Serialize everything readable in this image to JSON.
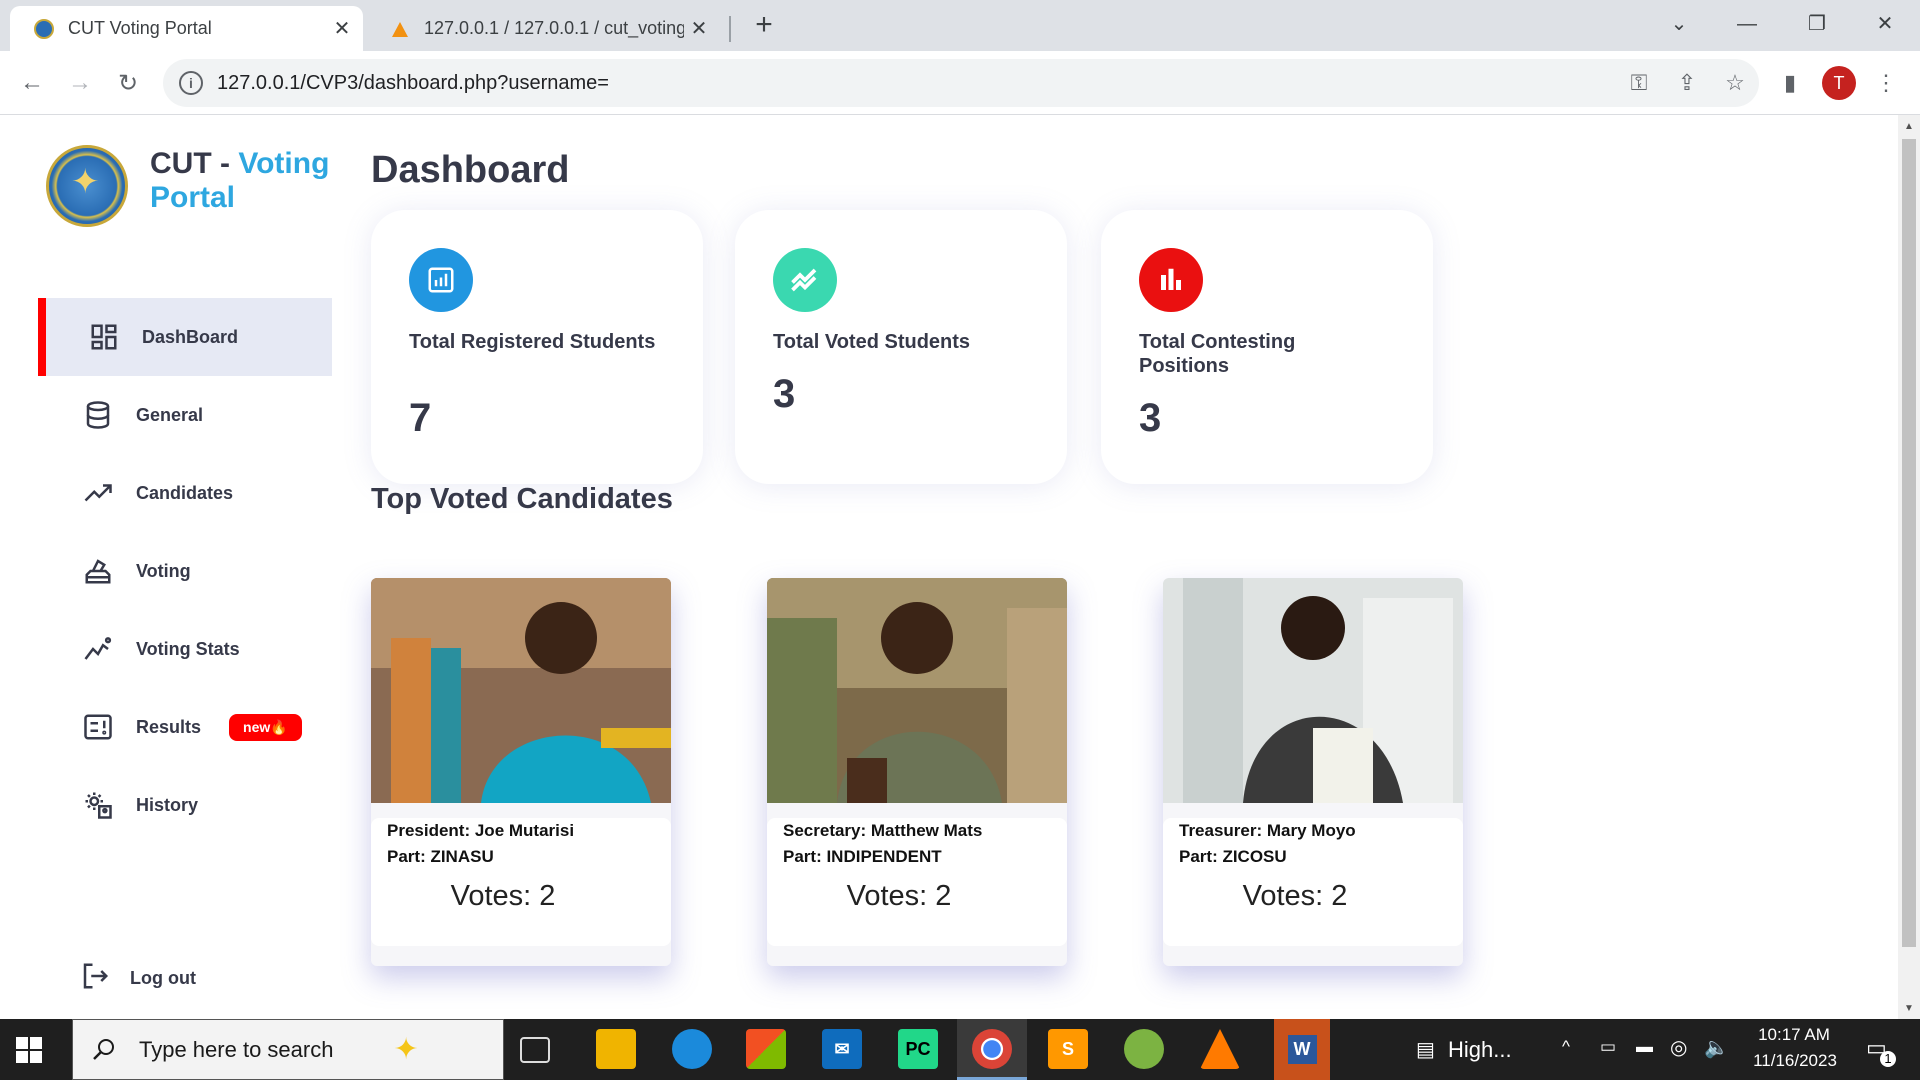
{
  "browser": {
    "tabs": [
      {
        "title": "CUT Voting Portal",
        "active": true
      },
      {
        "title": "127.0.0.1 / 127.0.0.1 / cut_voting",
        "active": false
      }
    ],
    "url": "127.0.0.1/CVP3/dashboard.php?username=",
    "profile_initial": "T"
  },
  "brand": {
    "part1": "CUT - ",
    "part2": "Voting",
    "part3": "Portal"
  },
  "sidebar": {
    "items": [
      {
        "label": "DashBoard",
        "icon": "grid-icon",
        "active": true
      },
      {
        "label": "General",
        "icon": "database-icon"
      },
      {
        "label": "Candidates",
        "icon": "trending-up-icon"
      },
      {
        "label": "Voting",
        "icon": "ballot-icon"
      },
      {
        "label": "Voting Stats",
        "icon": "stats-icon"
      },
      {
        "label": "Results",
        "icon": "results-icon",
        "badge": "new🔥"
      },
      {
        "label": "History",
        "icon": "history-icon"
      }
    ],
    "logout": "Log out"
  },
  "main": {
    "title": "Dashboard",
    "stats": [
      {
        "label": "Total Registered Students",
        "value": "7",
        "color": "#2196e0"
      },
      {
        "label": "Total Voted Students",
        "value": "3",
        "color": "#3ad8b0"
      },
      {
        "label": "Total Contesting Positions",
        "value": "3",
        "color": "#ea1010"
      }
    ],
    "section_title": "Top Voted Candidates",
    "candidates": [
      {
        "line1": "President: Joe Mutarisi",
        "line2": "Part: ZINASU",
        "votes": "Votes: 2"
      },
      {
        "line1": "Secretary: Matthew Mats",
        "line2": "Part: INDIPENDENT",
        "votes": "Votes: 2"
      },
      {
        "line1": "Treasurer: Mary Moyo",
        "line2": "Part: ZICOSU",
        "votes": "Votes: 2"
      }
    ]
  },
  "taskbar": {
    "search_placeholder": "Type here to search",
    "weather": "High...",
    "time": "10:17 AM",
    "date": "11/16/2023",
    "notifications": "1"
  }
}
